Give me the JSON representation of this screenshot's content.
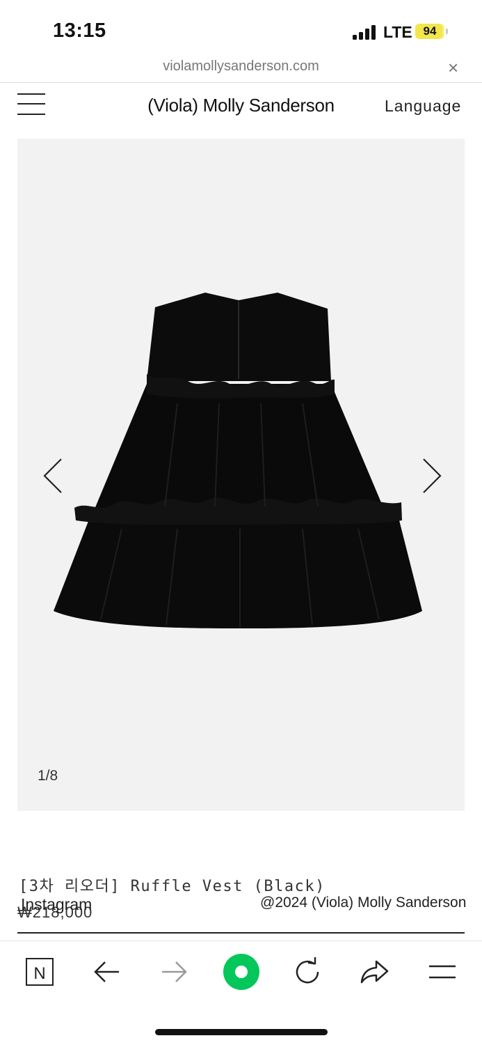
{
  "status_bar": {
    "time": "13:15",
    "network": "LTE",
    "battery": "94",
    "battery_level": 0.94
  },
  "browser": {
    "url": "violamollysanderson.com",
    "close_glyph": "×"
  },
  "header": {
    "brand": "(Viola) Molly Sanderson",
    "language": "Language"
  },
  "gallery": {
    "counter": "1/8",
    "image_alt": "Ruffle Vest (Black)"
  },
  "product": {
    "name": "[3차 리오더] Ruffle Vest (Black)",
    "price": "₩218,000"
  },
  "footer": {
    "instagram": "Instagram",
    "copyright": "@2024 (Viola) Molly Sanderson"
  },
  "toolbar": {
    "home_letter": "N",
    "accent": "#03c75a"
  },
  "colors": {
    "gallery_bg": "#f2f2f2",
    "battery": "#f2e64a"
  }
}
